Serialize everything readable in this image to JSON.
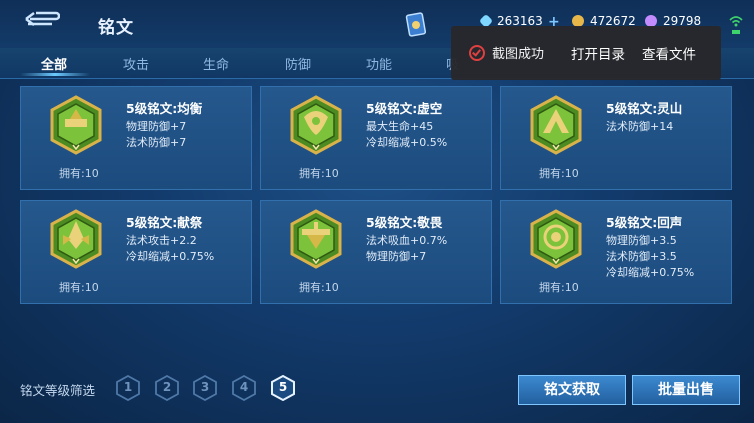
{
  "header": {
    "title": "铭文",
    "resources": [
      {
        "icon": "diamond-icon",
        "value": "263163",
        "color": "#7fd7ff"
      },
      {
        "icon": "gold-coin-icon",
        "value": "472672",
        "color": "#e7b74a"
      },
      {
        "icon": "gem-purple-icon",
        "value": "29798",
        "color": "#c28cff"
      }
    ]
  },
  "tabs": [
    {
      "label": "全部",
      "active": true
    },
    {
      "label": "攻击",
      "active": false
    },
    {
      "label": "生命",
      "active": false
    },
    {
      "label": "防御",
      "active": false
    },
    {
      "label": "功能",
      "active": false
    },
    {
      "label": "吸",
      "active": false
    }
  ],
  "toast": {
    "message": "截图成功",
    "open_dir": "打开目录",
    "view_file": "查看文件"
  },
  "inscriptions": [
    {
      "name": "5级铭文:均衡",
      "attrs": [
        "物理防御+7",
        "法术防御+7"
      ],
      "owned": "拥有:10"
    },
    {
      "name": "5级铭文:虚空",
      "attrs": [
        "最大生命+45",
        "冷却缩减+0.5%"
      ],
      "owned": "拥有:10"
    },
    {
      "name": "5级铭文:灵山",
      "attrs": [
        "法术防御+14"
      ],
      "owned": "拥有:10"
    },
    {
      "name": "5级铭文:献祭",
      "attrs": [
        "法术攻击+2.2",
        "冷却缩减+0.75%"
      ],
      "owned": "拥有:10"
    },
    {
      "name": "5级铭文:敬畏",
      "attrs": [
        "法术吸血+0.7%",
        "物理防御+7"
      ],
      "owned": "拥有:10"
    },
    {
      "name": "5级铭文:回声",
      "attrs": [
        "物理防御+3.5",
        "法术防御+3.5",
        "冷却缩减+0.75%"
      ],
      "owned": "拥有:10"
    }
  ],
  "filter": {
    "label": "铭文等级筛选",
    "levels": [
      "1",
      "2",
      "3",
      "4",
      "5"
    ],
    "selected": "5"
  },
  "buttons": {
    "obtain": "铭文获取",
    "bulk_sell": "批量出售"
  },
  "colors": {
    "accent": "#6ccaff",
    "emblem_gold": "#c9a23a",
    "emblem_green": "#5fa82e"
  }
}
